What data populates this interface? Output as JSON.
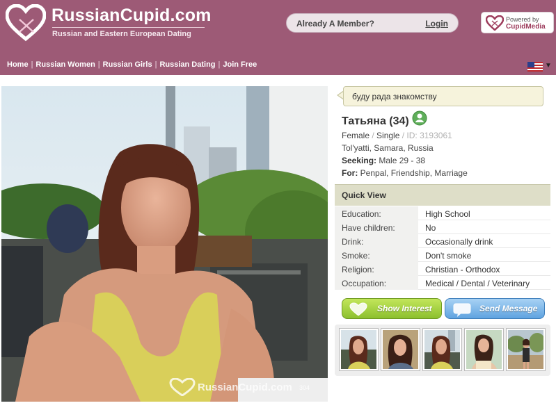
{
  "brand": {
    "title": "RussianCupid.com",
    "tagline": "Russian and Eastern European Dating"
  },
  "header": {
    "member_prompt": "Already A Member?",
    "login_label": "Login",
    "powered_by": "Powered by",
    "powered_brand": "CupidMedia"
  },
  "nav": {
    "items": [
      "Home",
      "Russian Women",
      "Russian Girls",
      "Russian Dating",
      "Join Free"
    ],
    "separator": "|",
    "language_flag": "us-flag-icon"
  },
  "photo": {
    "watermark": "RussianCupid.com",
    "watermark_number": "304"
  },
  "profile": {
    "headline": "буду рада знакомству",
    "name": "Татьяна (34)",
    "gender": "Female",
    "status": "Single",
    "id_label": "ID: 3193061",
    "location": "Tol'yatti, Samara, Russia",
    "seeking_label": "Seeking:",
    "seeking_value": "Male 29 - 38",
    "for_label": "For:",
    "for_value": "Penpal, Friendship, Marriage"
  },
  "quick_view": {
    "title": "Quick View",
    "rows": [
      {
        "key": "Education:",
        "value": "High School"
      },
      {
        "key": "Have children:",
        "value": "No"
      },
      {
        "key": "Drink:",
        "value": "Occasionally drink"
      },
      {
        "key": "Smoke:",
        "value": "Don't smoke"
      },
      {
        "key": "Religion:",
        "value": "Christian - Orthodox"
      },
      {
        "key": "Occupation:",
        "value": "Medical / Dental / Veterinary"
      }
    ]
  },
  "actions": {
    "interest_label": "Show Interest",
    "message_label": "Send Message"
  },
  "colors": {
    "header_bg": "#9d5a76",
    "interest_green": "#8cc02e",
    "message_blue": "#5fa3e0",
    "quick_view_bg": "#dedec8",
    "headline_bg": "#f6f3dc"
  }
}
